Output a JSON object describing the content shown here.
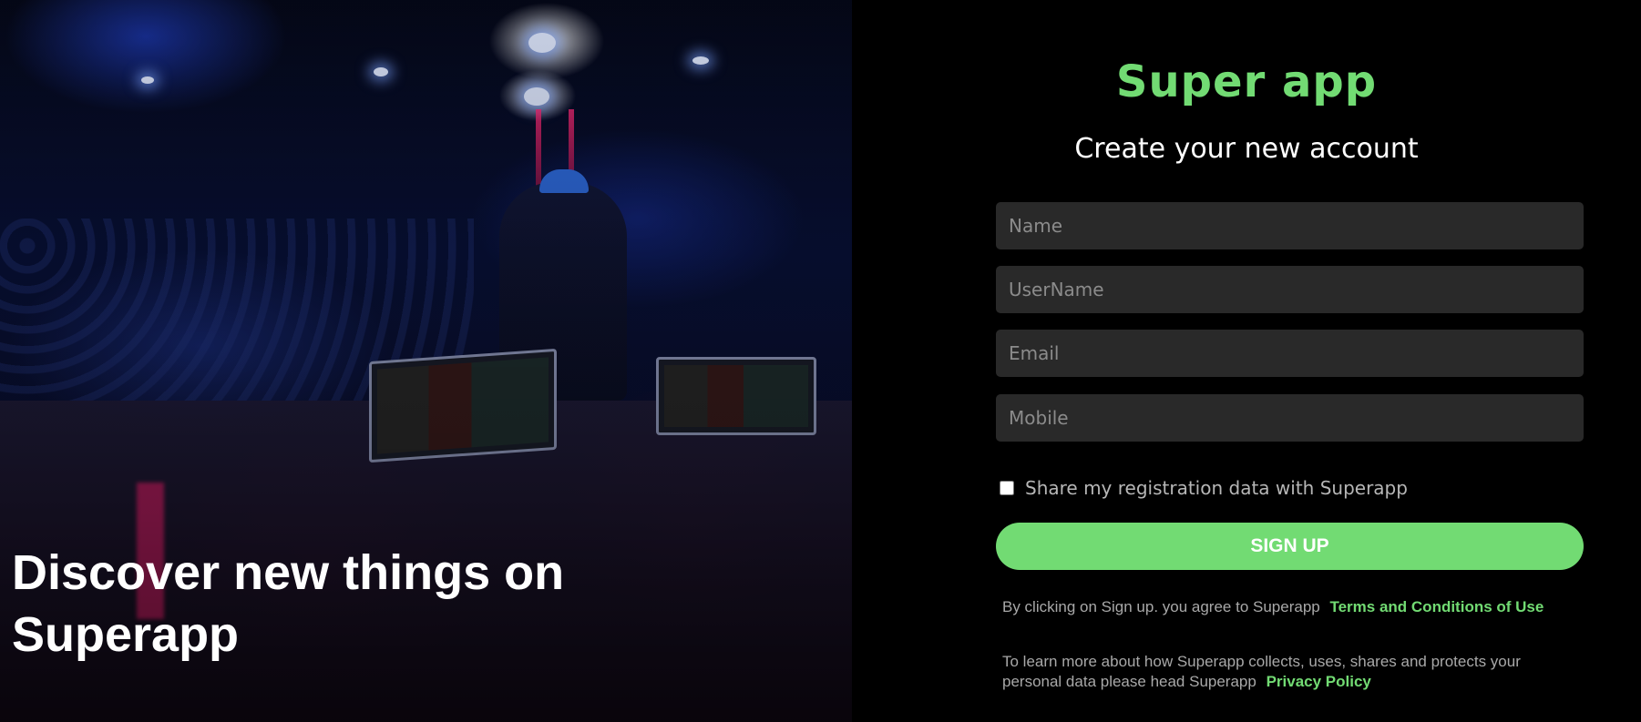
{
  "hero": {
    "title": "Discover new things on Superapp"
  },
  "brand": {
    "name": "Super app",
    "color": "#72db73"
  },
  "form": {
    "heading": "Create your new account",
    "fields": [
      {
        "placeholder": "Name",
        "value": ""
      },
      {
        "placeholder": "UserName",
        "value": ""
      },
      {
        "placeholder": "Email",
        "value": ""
      },
      {
        "placeholder": "Mobile",
        "value": ""
      }
    ],
    "share_checkbox": {
      "label": "Share my registration data with Superapp",
      "checked": false
    },
    "submit_label": "SIGN UP"
  },
  "legal": {
    "terms_text": "By clicking on Sign up. you agree to Superapp",
    "terms_link": "Terms and Conditions of Use",
    "privacy_text": "To learn more about how Superapp collects, uses, shares and protects your personal data please head Superapp",
    "privacy_link": "Privacy Policy"
  },
  "colors": {
    "accent": "#72db73",
    "field_bg": "#292929",
    "panel_bg": "#000000"
  }
}
